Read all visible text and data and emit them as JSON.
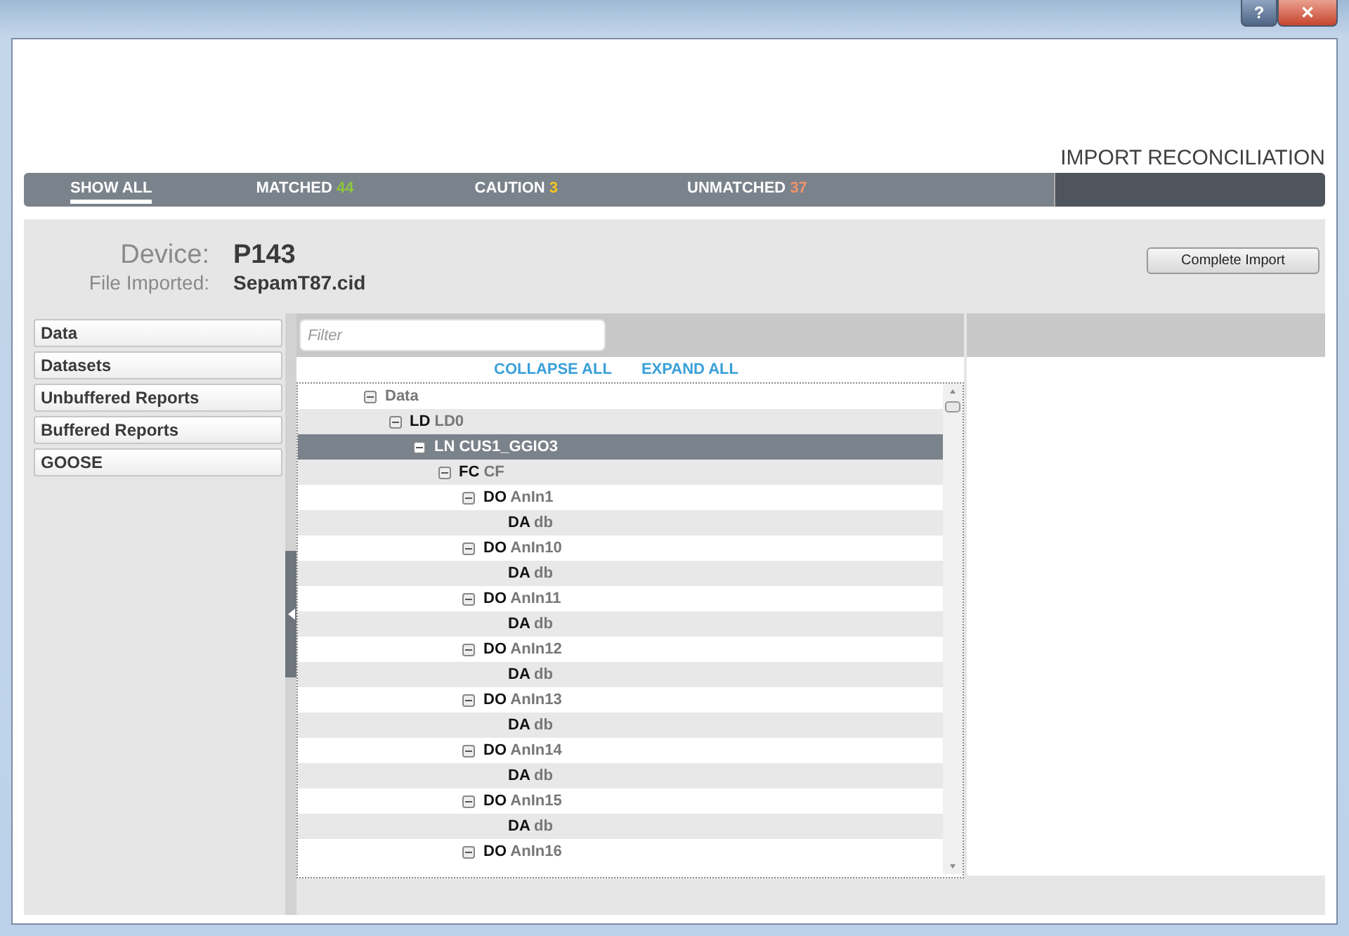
{
  "window": {
    "buttons": [
      "?",
      "✕"
    ]
  },
  "header": {
    "title": "IMPORT RECONCILIATION"
  },
  "filters": [
    {
      "label": "SHOW ALL",
      "selected": true
    },
    {
      "label": "MATCHED",
      "count": "44",
      "color": "#8dc63f",
      "selected": false
    },
    {
      "label": "CAUTION",
      "count": "3",
      "color": "#f7c51e",
      "selected": false
    },
    {
      "label": "UNMATCHED",
      "count": "37",
      "color": "#f0946b",
      "selected": false
    }
  ],
  "device": {
    "device_label": "Device:",
    "device_value": "P143",
    "file_label": "File Imported:",
    "file_value": "SepamT87.cid",
    "action": "Complete Import"
  },
  "sidebar": {
    "items": [
      {
        "label": "Data",
        "selected": false
      },
      {
        "label": "Datasets",
        "selected": false
      },
      {
        "label": "Unbuffered Reports",
        "selected": false
      },
      {
        "label": "Buffered Reports",
        "selected": false
      },
      {
        "label": "GOOSE",
        "selected": false
      }
    ]
  },
  "filter_field": {
    "placeholder": "Filter"
  },
  "tree_actions": [
    "COLLAPSE ALL",
    "EXPAND ALL"
  ],
  "tree": [
    {
      "name": "Data",
      "expanded": true,
      "selected": false,
      "children": [
        {
          "type": "LD",
          "name": "LD0",
          "expanded": true,
          "selected": false,
          "children": [
            {
              "type": "LN",
              "name": "CUS1_GGIO3",
              "expanded": true,
              "selected": true,
              "children": [
                {
                  "type": "FC",
                  "name": "CF",
                  "expanded": true,
                  "selected": false,
                  "children": [
                    {
                      "type": "DO",
                      "name": "AnIn1",
                      "expanded": true,
                      "selected": false,
                      "children": [
                        {
                          "type": "DA",
                          "name": "db",
                          "selected": false
                        }
                      ]
                    },
                    {
                      "type": "DO",
                      "name": "AnIn10",
                      "expanded": true,
                      "selected": false,
                      "children": [
                        {
                          "type": "DA",
                          "name": "db",
                          "selected": false
                        }
                      ]
                    },
                    {
                      "type": "DO",
                      "name": "AnIn11",
                      "expanded": true,
                      "selected": false,
                      "children": [
                        {
                          "type": "DA",
                          "name": "db",
                          "selected": false
                        }
                      ]
                    },
                    {
                      "type": "DO",
                      "name": "AnIn12",
                      "expanded": true,
                      "selected": false,
                      "children": [
                        {
                          "type": "DA",
                          "name": "db",
                          "selected": false
                        }
                      ]
                    },
                    {
                      "type": "DO",
                      "name": "AnIn13",
                      "expanded": true,
                      "selected": false,
                      "children": [
                        {
                          "type": "DA",
                          "name": "db",
                          "selected": false
                        }
                      ]
                    },
                    {
                      "type": "DO",
                      "name": "AnIn14",
                      "expanded": true,
                      "selected": false,
                      "children": [
                        {
                          "type": "DA",
                          "name": "db",
                          "selected": false
                        }
                      ]
                    },
                    {
                      "type": "DO",
                      "name": "AnIn15",
                      "expanded": true,
                      "selected": false,
                      "children": [
                        {
                          "type": "DA",
                          "name": "db",
                          "selected": false
                        }
                      ]
                    },
                    {
                      "type": "DO",
                      "name": "AnIn16",
                      "expanded": true,
                      "selected": false
                    }
                  ]
                }
              ]
            }
          ]
        }
      ]
    }
  ]
}
